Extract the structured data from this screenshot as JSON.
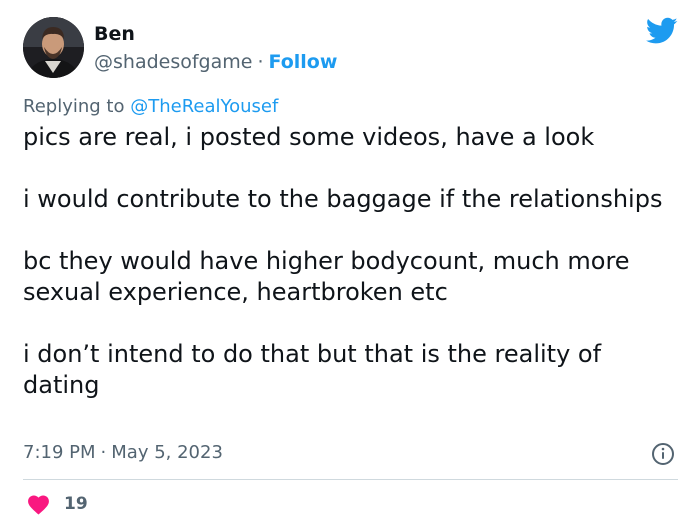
{
  "author": {
    "name": "Ben",
    "handle": "@shadesofgame",
    "separator": "·",
    "follow_label": "Follow"
  },
  "reply": {
    "prefix": "Replying to",
    "mention": "@TheRealYousef"
  },
  "tweet": {
    "paragraphs": [
      "pics are real, i posted some videos, have a look",
      "i would contribute to the baggage if the relationships",
      "bc they would have higher bodycount, much more sexual experience, heartbroken etc",
      "i don’t intend to do that but that is the reality of dating"
    ]
  },
  "meta": {
    "time": "7:19 PM",
    "separator": "·",
    "date": "May 5, 2023"
  },
  "engagement": {
    "likes": "19"
  },
  "icons": {
    "brand": "twitter-bird-icon",
    "info": "info-icon",
    "like": "heart-icon"
  },
  "colors": {
    "brand_blue": "#1d9bf0",
    "text_primary": "#0f1419",
    "text_secondary": "#536471",
    "like_red": "#f91880",
    "divider": "#cfd9de"
  }
}
